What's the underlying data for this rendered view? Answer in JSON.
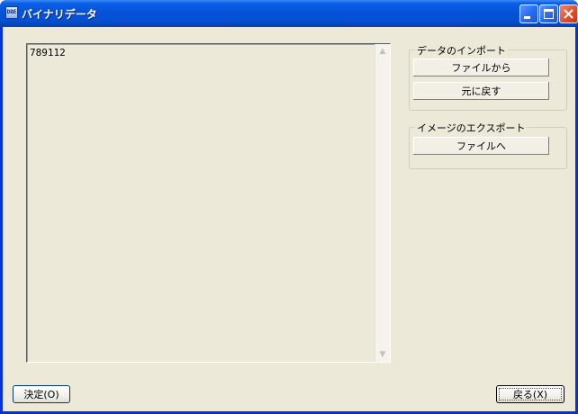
{
  "window": {
    "title": "バイナリデータ",
    "app_icon_text": "DBE"
  },
  "data_box": {
    "content": "789112"
  },
  "import_group": {
    "legend": "データのインポート",
    "from_file_label": "ファイルから",
    "restore_label": "元に戻す"
  },
  "export_group": {
    "legend": "イメージのエクスポート",
    "to_file_label": "ファイルへ"
  },
  "footer": {
    "ok_label": "決定(O)",
    "back_label": "戻る(X)"
  },
  "colors": {
    "titlebar": "#0553d9",
    "dialog_face": "#ece9d8",
    "button_border": "#003c74",
    "close_button": "#d9542c"
  }
}
